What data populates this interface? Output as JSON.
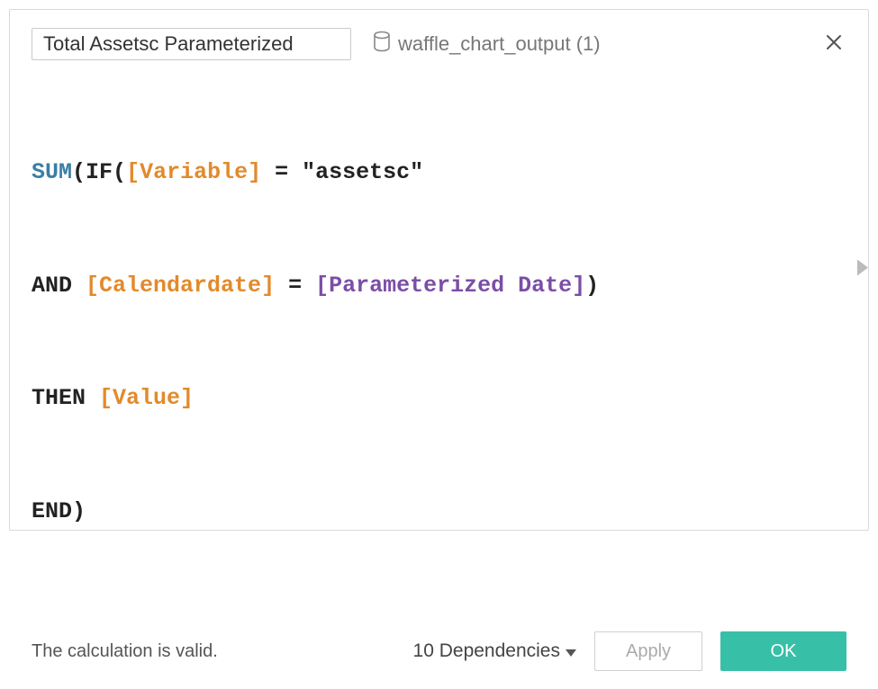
{
  "header": {
    "calc_name": "Total Assetsc Parameterized",
    "datasource_label": "waffle_chart_output (1)"
  },
  "formula": {
    "line1": {
      "fn": "SUM",
      "kw": "IF",
      "field": "[Variable]",
      "op": " = ",
      "str": "\"assetsc\""
    },
    "line2": {
      "kw": "AND",
      "field": "[Calendardate]",
      "op": " = ",
      "param": "[Parameterized Date]"
    },
    "line3": {
      "kw": "THEN",
      "field": "[Value]"
    },
    "line4": {
      "kw": "END"
    }
  },
  "footer": {
    "status": "The calculation is valid.",
    "dependencies_label": "10 Dependencies",
    "apply_label": "Apply",
    "ok_label": "OK"
  }
}
